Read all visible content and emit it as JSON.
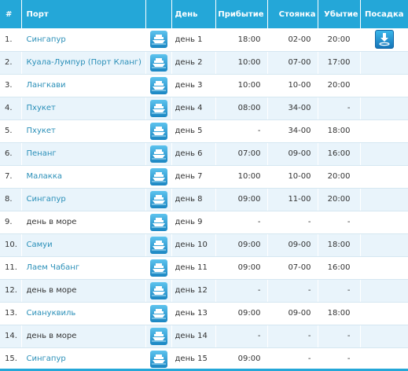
{
  "header": {
    "num": "#",
    "port": "Порт",
    "day": "День",
    "arrival": "Прибытие",
    "stay": "Стоянка",
    "departure": "Убытие",
    "boarding": "Посадка"
  },
  "rows": [
    {
      "num": "1.",
      "port": "Сингапур",
      "is_port": true,
      "day": "день 1",
      "arrival": "18:00",
      "stay": "02-00",
      "departure": "20:00",
      "boarding": true
    },
    {
      "num": "2.",
      "port": "Куала-Лумпур (Порт Кланг)",
      "is_port": true,
      "day": "день 2",
      "arrival": "10:00",
      "stay": "07-00",
      "departure": "17:00",
      "boarding": false
    },
    {
      "num": "3.",
      "port": "Лангкави",
      "is_port": true,
      "day": "день 3",
      "arrival": "10:00",
      "stay": "10-00",
      "departure": "20:00",
      "boarding": false
    },
    {
      "num": "4.",
      "port": "Пхукет",
      "is_port": true,
      "day": "день 4",
      "arrival": "08:00",
      "stay": "34-00",
      "departure": "-",
      "boarding": false
    },
    {
      "num": "5.",
      "port": "Пхукет",
      "is_port": true,
      "day": "день 5",
      "arrival": "-",
      "stay": "34-00",
      "departure": "18:00",
      "boarding": false
    },
    {
      "num": "6.",
      "port": "Пенанг",
      "is_port": true,
      "day": "день 6",
      "arrival": "07:00",
      "stay": "09-00",
      "departure": "16:00",
      "boarding": false
    },
    {
      "num": "7.",
      "port": "Малакка",
      "is_port": true,
      "day": "день 7",
      "arrival": "10:00",
      "stay": "10-00",
      "departure": "20:00",
      "boarding": false
    },
    {
      "num": "8.",
      "port": "Сингапур",
      "is_port": true,
      "day": "день 8",
      "arrival": "09:00",
      "stay": "11-00",
      "departure": "20:00",
      "boarding": false
    },
    {
      "num": "9.",
      "port": "день в море",
      "is_port": false,
      "day": "день 9",
      "arrival": "-",
      "stay": "-",
      "departure": "-",
      "boarding": false
    },
    {
      "num": "10.",
      "port": "Самуи",
      "is_port": true,
      "day": "день 10",
      "arrival": "09:00",
      "stay": "09-00",
      "departure": "18:00",
      "boarding": false
    },
    {
      "num": "11.",
      "port": "Лаем Чабанг",
      "is_port": true,
      "day": "день 11",
      "arrival": "09:00",
      "stay": "07-00",
      "departure": "16:00",
      "boarding": false
    },
    {
      "num": "12.",
      "port": "день в море",
      "is_port": false,
      "day": "день 12",
      "arrival": "-",
      "stay": "-",
      "departure": "-",
      "boarding": false
    },
    {
      "num": "13.",
      "port": "Сиануквиль",
      "is_port": true,
      "day": "день 13",
      "arrival": "09:00",
      "stay": "09-00",
      "departure": "18:00",
      "boarding": false
    },
    {
      "num": "14.",
      "port": "день в море",
      "is_port": false,
      "day": "день 14",
      "arrival": "-",
      "stay": "-",
      "departure": "-",
      "boarding": false
    },
    {
      "num": "15.",
      "port": "Сингапур",
      "is_port": true,
      "day": "день 15",
      "arrival": "09:00",
      "stay": "-",
      "departure": "-",
      "boarding": false
    }
  ],
  "icons": {
    "ship": "ship-icon",
    "boarding": "boarding-download-icon"
  },
  "colors": {
    "header_bg": "#24a7d8",
    "row_alt_bg": "#e9f4fb",
    "link": "#2a8fb8"
  }
}
